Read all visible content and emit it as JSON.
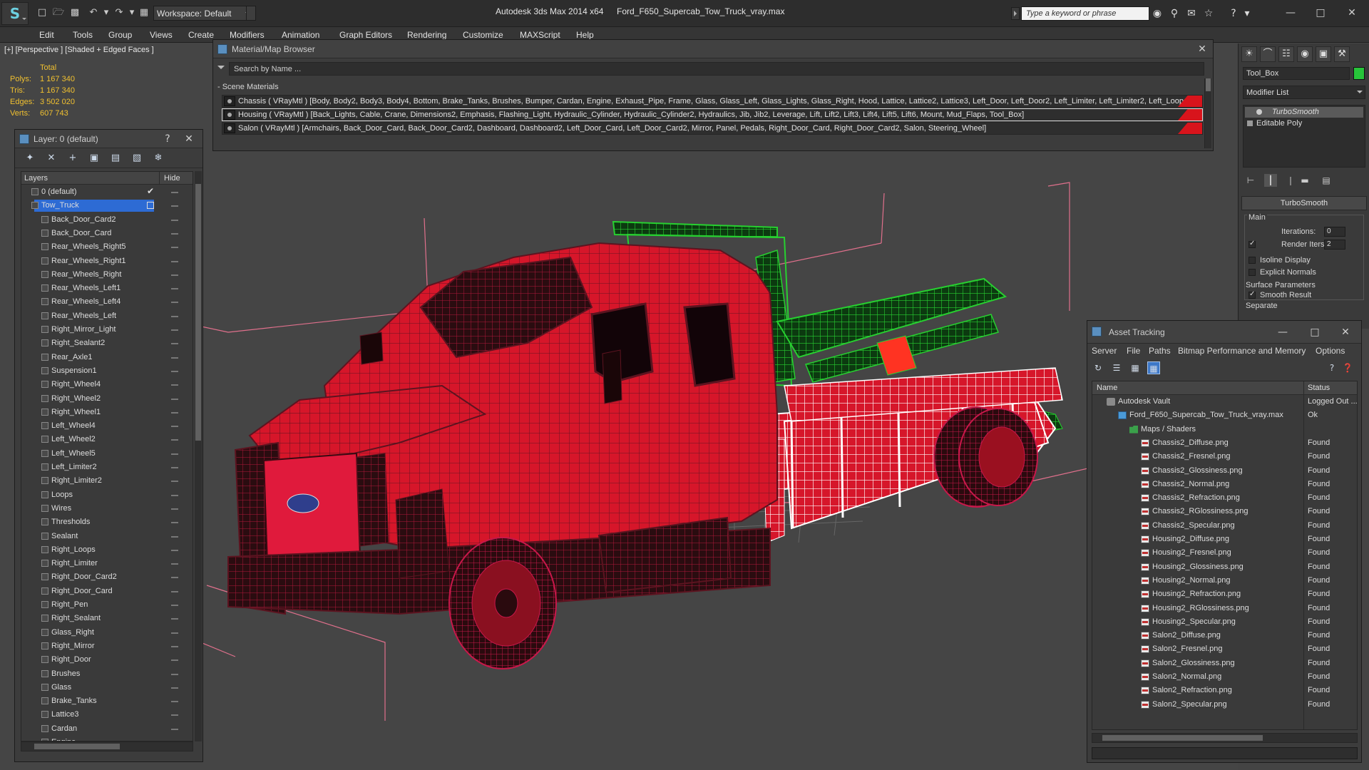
{
  "titlebar": {
    "workspace": "Workspace: Default",
    "app_title": "Autodesk 3ds Max  2014 x64",
    "file_title": "Ford_F650_Supercab_Tow_Truck_vray.max",
    "search_placeholder": "Type a keyword or phrase"
  },
  "menu": [
    "Edit",
    "Tools",
    "Group",
    "Views",
    "Create",
    "Modifiers",
    "Animation",
    "Graph Editors",
    "Rendering",
    "Customize",
    "MAXScript",
    "Help"
  ],
  "viewport": {
    "label": "[+] [Perspective ] [Shaded + Edged Faces ]",
    "stats": {
      "total_label": "Total",
      "rows": [
        {
          "k": "Polys:",
          "v": "1 167 340"
        },
        {
          "k": "Tris:",
          "v": "1 167 340"
        },
        {
          "k": "Edges:",
          "v": "3 502 020"
        },
        {
          "k": "Verts:",
          "v": "607 743"
        }
      ]
    },
    "colors": {
      "body": "#d6162a",
      "wire": "#5c1420",
      "boom": "#1bb024",
      "bed_wire": "#ffffff",
      "helper": "#e0708c"
    }
  },
  "material_browser": {
    "title": "Material/Map Browser",
    "search_placeholder": "Search by Name ...",
    "section": "- Scene Materials",
    "rows": [
      {
        "text": "Chassis  ( VRayMtl ) [Body, Body2, Body3, Body4, Bottom, Brake_Tanks, Brushes, Bumper, Cardan, Engine, Exhaust_Pipe, Frame, Glass, Glass_Left, Glass_Lights, Glass_Right, Hood, Lattice, Lattice2, Lattice3, Left_Door, Left_Door2, Left_Limiter, Left_Limiter2, Left_Loop..."
      },
      {
        "text": "Housing  ( VRayMtl ) [Back_Lights, Cable, Crane, Dimensions2, Emphasis, Flashing_Light, Hydraulic_Cylinder, Hydraulic_Cylinder2, Hydraulics, Jib, Jib2, Leverage, Lift, Lift2, Lift3, Lift4, Lift5, Lift6, Mount, Mud_Flaps, Tool_Box]"
      },
      {
        "text": "Salon  ( VRayMtl ) [Armchairs, Back_Door_Card, Back_Door_Card2, Dashboard, Dashboard2, Left_Door_Card, Left_Door_Card2, Mirror, Panel, Pedals, Right_Door_Card, Right_Door_Card2, Salon, Steering_Wheel]"
      }
    ]
  },
  "layers": {
    "title": "Layer: 0 (default)",
    "col_layers": "Layers",
    "col_hide": "Hide",
    "items": [
      "0 (default)",
      "Tow_Truck",
      "Back_Door_Card2",
      "Back_Door_Card",
      "Rear_Wheels_Right5",
      "Rear_Wheels_Right1",
      "Rear_Wheels_Right",
      "Rear_Wheels_Left1",
      "Rear_Wheels_Left4",
      "Rear_Wheels_Left",
      "Right_Mirror_Light",
      "Right_Sealant2",
      "Rear_Axle1",
      "Suspension1",
      "Right_Wheel4",
      "Right_Wheel2",
      "Right_Wheel1",
      "Left_Wheel4",
      "Left_Wheel2",
      "Left_Wheel5",
      "Left_Limiter2",
      "Right_Limiter2",
      "Loops",
      "Wires",
      "Thresholds",
      "Sealant",
      "Right_Loops",
      "Right_Limiter",
      "Right_Door_Card2",
      "Right_Door_Card",
      "Right_Pen",
      "Right_Sealant",
      "Glass_Right",
      "Right_Mirror",
      "Right_Door",
      "Brushes",
      "Glass",
      "Brake_Tanks",
      "Lattice3",
      "Cardan",
      "Engine"
    ]
  },
  "command_panel": {
    "object_name": "Tool_Box",
    "object_color": "#27c43a",
    "modifier_list": "Modifier List",
    "stack": [
      "TurboSmooth",
      "Editable Poly"
    ],
    "rollout": "TurboSmooth",
    "main_label": "Main",
    "iterations_label": "Iterations:",
    "iterations_value": "0",
    "render_iters_label": "Render Iters:",
    "render_iters_value": "2",
    "isoline": "Isoline Display",
    "explicit": "Explicit Normals",
    "surface": "Surface Parameters",
    "smooth": "Smooth Result",
    "separate": "Separate"
  },
  "asset_tracking": {
    "title": "Asset Tracking",
    "menu": [
      "Server",
      "File",
      "Paths",
      "Bitmap Performance and Memory",
      "Options"
    ],
    "col_name": "Name",
    "col_status": "Status",
    "rows": [
      {
        "name": "Autodesk Vault",
        "status": "Logged Out ...",
        "icon": "vault"
      },
      {
        "name": "Ford_F650_Supercab_Tow_Truck_vray.max",
        "status": "Ok",
        "icon": "max"
      },
      {
        "name": "Maps / Shaders",
        "status": "",
        "icon": "folder"
      },
      {
        "name": "Chassis2_Diffuse.png",
        "status": "Found",
        "icon": "png"
      },
      {
        "name": "Chassis2_Fresnel.png",
        "status": "Found",
        "icon": "png"
      },
      {
        "name": "Chassis2_Glossiness.png",
        "status": "Found",
        "icon": "png"
      },
      {
        "name": "Chassis2_Normal.png",
        "status": "Found",
        "icon": "png"
      },
      {
        "name": "Chassis2_Refraction.png",
        "status": "Found",
        "icon": "png"
      },
      {
        "name": "Chassis2_RGlossiness.png",
        "status": "Found",
        "icon": "png"
      },
      {
        "name": "Chassis2_Specular.png",
        "status": "Found",
        "icon": "png"
      },
      {
        "name": "Housing2_Diffuse.png",
        "status": "Found",
        "icon": "png"
      },
      {
        "name": "Housing2_Fresnel.png",
        "status": "Found",
        "icon": "png"
      },
      {
        "name": "Housing2_Glossiness.png",
        "status": "Found",
        "icon": "png"
      },
      {
        "name": "Housing2_Normal.png",
        "status": "Found",
        "icon": "png"
      },
      {
        "name": "Housing2_Refraction.png",
        "status": "Found",
        "icon": "png"
      },
      {
        "name": "Housing2_RGlossiness.png",
        "status": "Found",
        "icon": "png"
      },
      {
        "name": "Housing2_Specular.png",
        "status": "Found",
        "icon": "png"
      },
      {
        "name": "Salon2_Diffuse.png",
        "status": "Found",
        "icon": "png"
      },
      {
        "name": "Salon2_Fresnel.png",
        "status": "Found",
        "icon": "png"
      },
      {
        "name": "Salon2_Glossiness.png",
        "status": "Found",
        "icon": "png"
      },
      {
        "name": "Salon2_Normal.png",
        "status": "Found",
        "icon": "png"
      },
      {
        "name": "Salon2_Refraction.png",
        "status": "Found",
        "icon": "png"
      },
      {
        "name": "Salon2_Specular.png",
        "status": "Found",
        "icon": "png"
      }
    ]
  }
}
